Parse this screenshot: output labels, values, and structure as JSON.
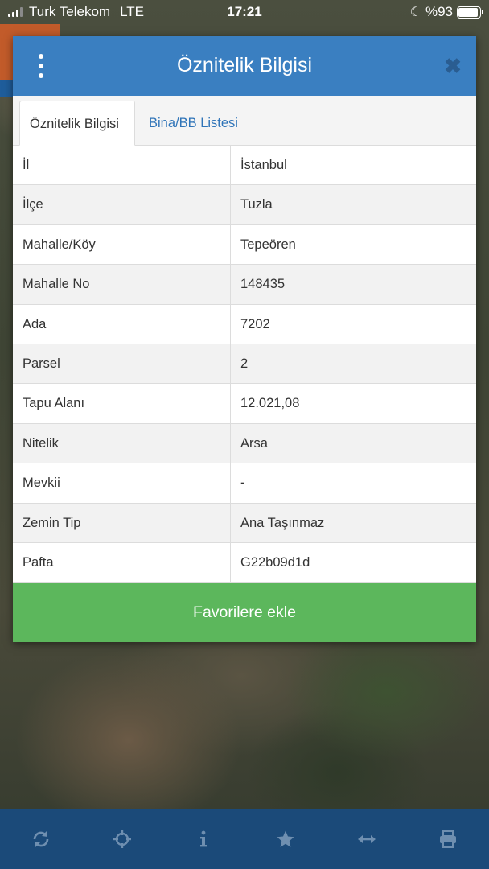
{
  "status_bar": {
    "carrier": "Turk Telekom",
    "network": "LTE",
    "time": "17:21",
    "battery": "%93",
    "battery_level": 0.93
  },
  "dialog": {
    "title": "Öznitelik Bilgisi",
    "menu_icon": "vertical-dots-icon",
    "close_icon": "close-icon",
    "tabs": [
      {
        "label": "Öznitelik Bilgisi",
        "active": true
      },
      {
        "label": "Bina/BB Listesi",
        "active": false
      }
    ],
    "rows": [
      {
        "key": "İl",
        "value": "İstanbul"
      },
      {
        "key": "İlçe",
        "value": "Tuzla"
      },
      {
        "key": "Mahalle/Köy",
        "value": "Tepeören"
      },
      {
        "key": "Mahalle No",
        "value": "148435"
      },
      {
        "key": "Ada",
        "value": "7202"
      },
      {
        "key": "Parsel",
        "value": "2"
      },
      {
        "key": "Tapu Alanı",
        "value": "12.021,08"
      },
      {
        "key": "Nitelik",
        "value": "Arsa"
      },
      {
        "key": "Mevkii",
        "value": "-"
      },
      {
        "key": "Zemin Tip",
        "value": "Ana Taşınmaz"
      },
      {
        "key": "Pafta",
        "value": "G22b09d1d"
      }
    ],
    "favorite_button": "Favorilere ekle"
  },
  "toolbar": {
    "icons": [
      "refresh-icon",
      "crosshair-icon",
      "info-icon",
      "star-icon",
      "measure-icon",
      "print-icon"
    ]
  },
  "colors": {
    "header": "#3a7fc1",
    "button": "#5cb75c",
    "toolbar": "#1b4a79",
    "link": "#2f74b8"
  }
}
